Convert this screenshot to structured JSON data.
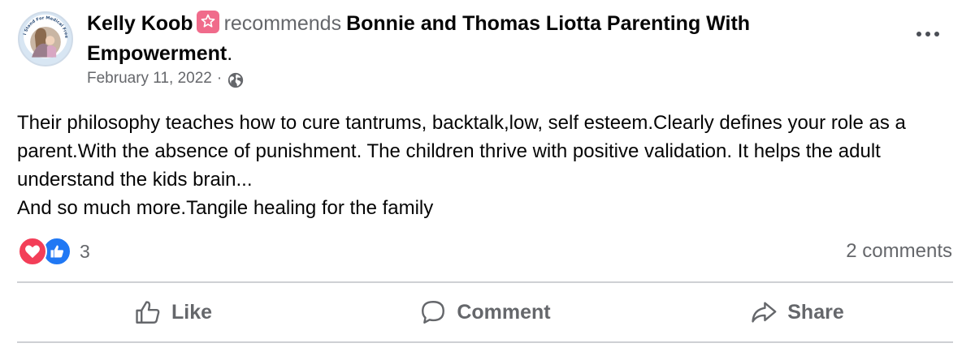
{
  "post": {
    "author": "Kelly Koob",
    "action_text": "recommends",
    "page_name": "Bonnie and Thomas Liotta Parenting With Empowerment",
    "period": ".",
    "date": "February 11, 2022",
    "date_separator": "·",
    "body": [
      "Their philosophy teaches how to cure tantrums, backtalk,low, self esteem.Clearly defines your role as a parent.With the absence of punishment. The children thrive with positive validation. It helps the adult understand the kids brain...",
      "And so much more.Tangile healing for the family"
    ],
    "avatar_ring_text": "I Stand For Medical Freedom"
  },
  "icons": {
    "avatar": "profile-photo",
    "badge": "star-badge-icon",
    "privacy": "globe-icon",
    "more": "more-options-icon",
    "reaction_love": "love-reaction-icon",
    "reaction_like": "like-reaction-icon",
    "like_action": "thumbs-up-icon",
    "comment_action": "comment-bubble-icon",
    "share_action": "share-arrow-icon"
  },
  "engagement": {
    "reaction_count": "3",
    "comments_label": "2 comments"
  },
  "actions": {
    "like_label": "Like",
    "comment_label": "Comment",
    "share_label": "Share"
  },
  "colors": {
    "text_primary": "#050505",
    "text_secondary": "#65676b",
    "badge": "#f06b8b",
    "love": "#f33e58",
    "like": "#2078f4",
    "divider": "#ced0d4"
  }
}
